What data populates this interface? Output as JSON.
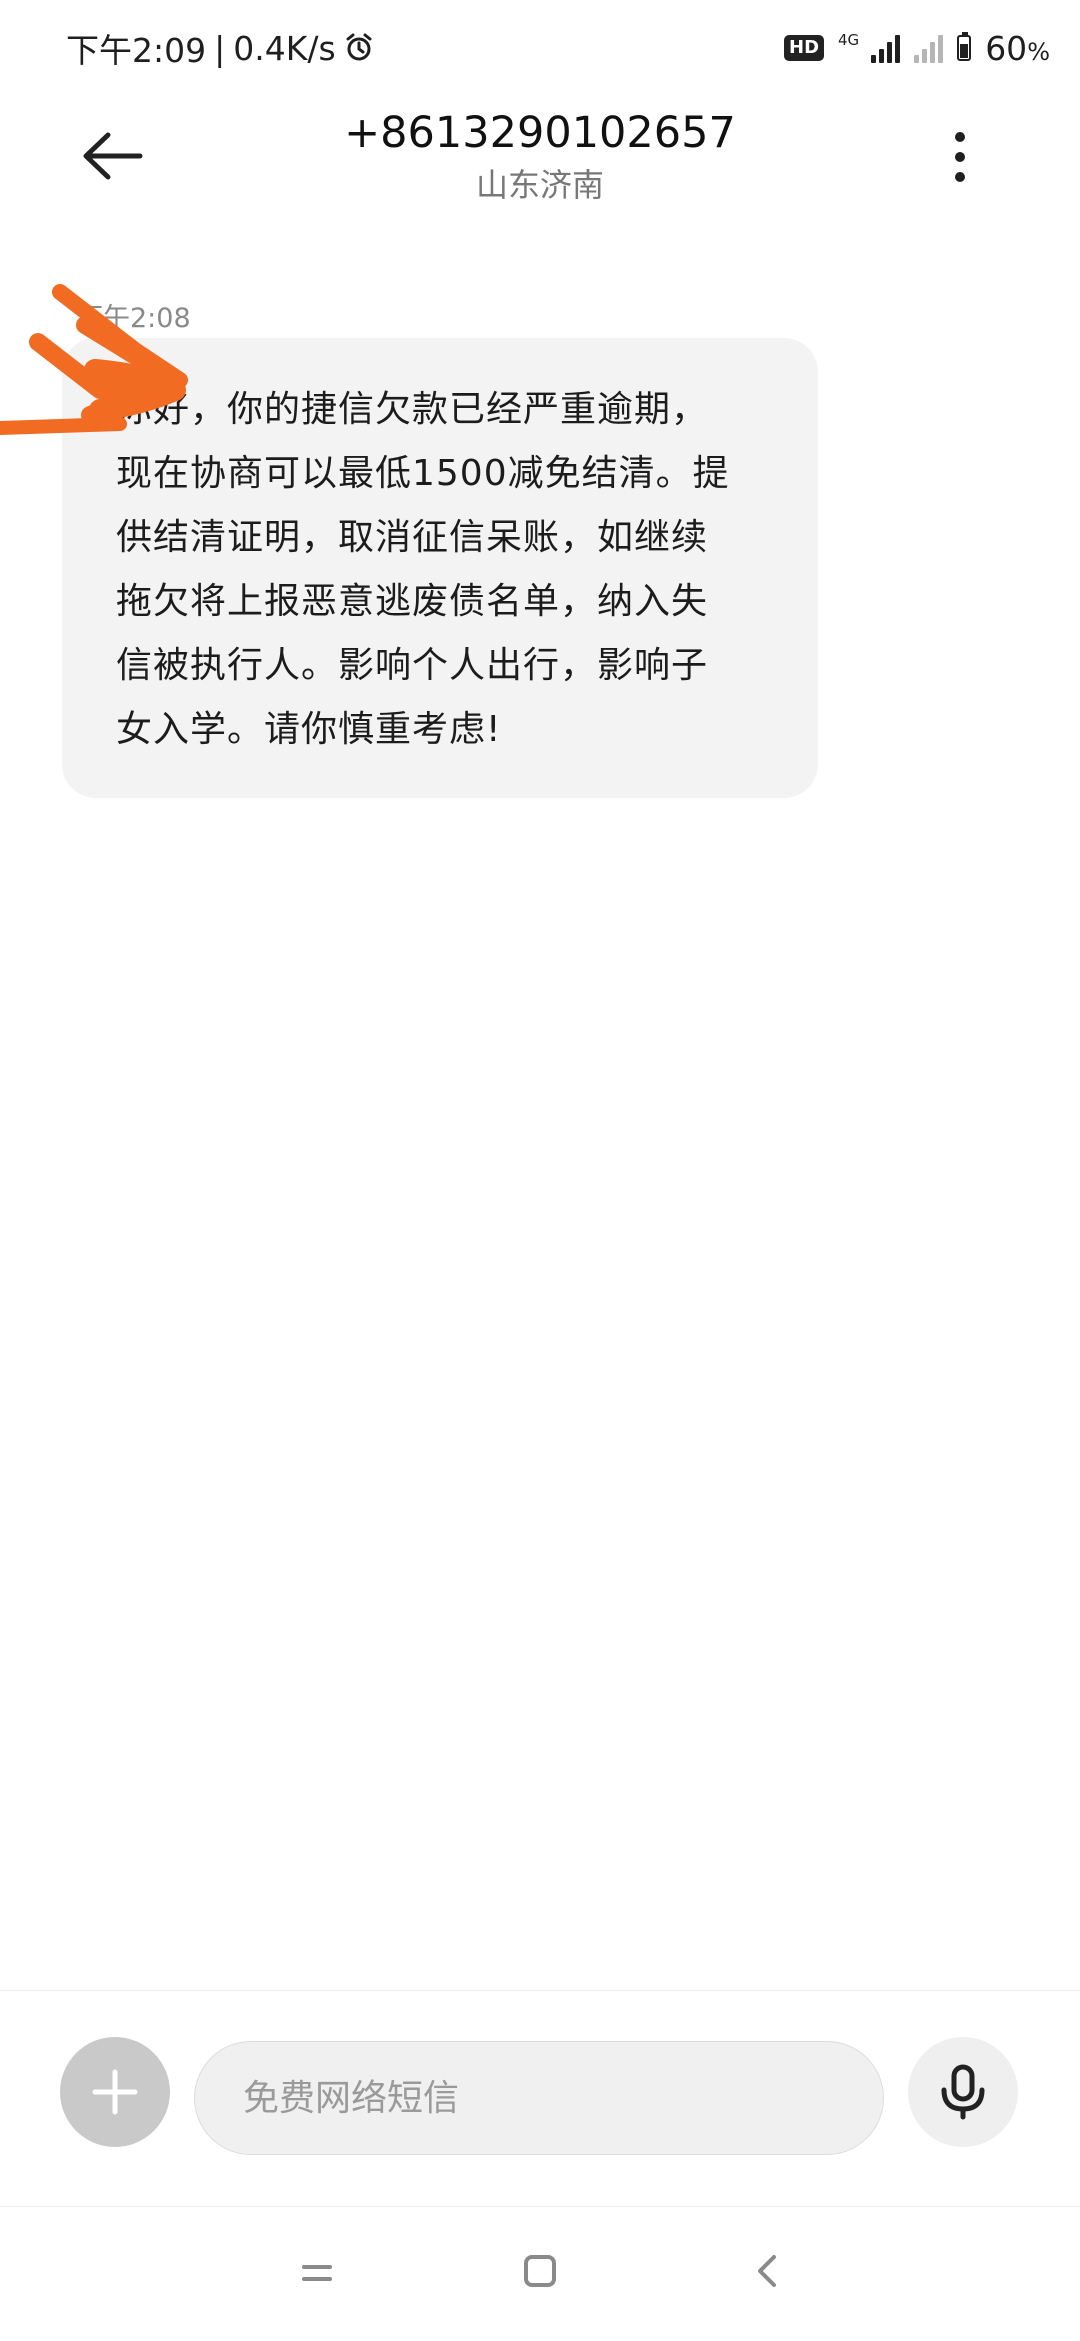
{
  "status_bar": {
    "time": "下午2:09",
    "speed": "0.4K/s",
    "hd_label": "HD",
    "network_label": "4G",
    "battery_percent": "60",
    "percent_sign": "%",
    "icons": [
      "alarm-icon",
      "signal-icon",
      "no-signal-icon",
      "battery-icon"
    ]
  },
  "header": {
    "contact_number": "+8613290102657",
    "contact_location": "山东济南",
    "back_icon": "arrow-left-icon",
    "more_icon": "more-vertical-icon"
  },
  "conversation": {
    "messages": [
      {
        "time": "下午2:08",
        "text": "你好，你的捷信欠款已经严重逾期，\n现在协商可以最低1500减免结清。提\n供结清证明，取消征信呆账，如继续\n拖欠将上报恶意逃废债名单，纳入失\n信被执行人。影响个人出行，影响子\n女入学。请你慎重考虑!"
      }
    ],
    "annotation_color": "#F26B22"
  },
  "composer": {
    "placeholder": "免费网络短信",
    "add_icon": "plus-icon",
    "mic_icon": "microphone-icon"
  },
  "nav_bar": {
    "icons": [
      "menu-icon",
      "home-icon",
      "back-icon"
    ]
  },
  "colors": {
    "bubble_bg": "#F3F3F3",
    "accent_scribble": "#F26B22"
  }
}
